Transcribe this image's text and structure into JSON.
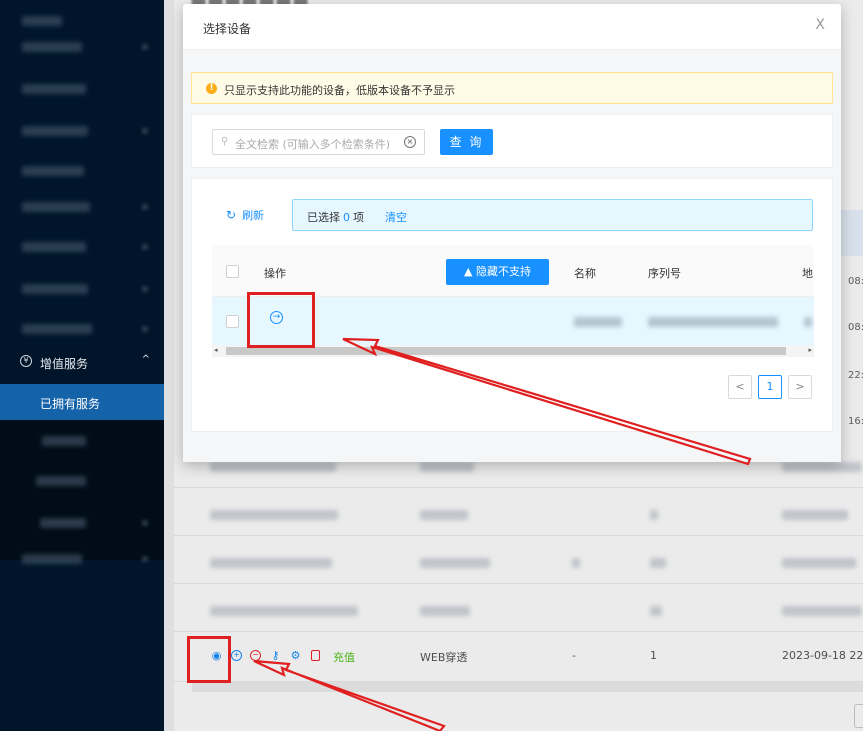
{
  "sidebar": {
    "group_label": "增值服务",
    "active_item": "已拥有服务"
  },
  "background": {
    "row": {
      "recharge_label": "充值",
      "name": "WEB穿透",
      "dash": "-",
      "count": "1",
      "date": "2023-09-18 22:"
    },
    "side_times": [
      "08:",
      "08:",
      "22:",
      "16:"
    ]
  },
  "modal": {
    "title": "选择设备",
    "close": "X",
    "notice": "只显示支持此功能的设备，低版本设备不予显示",
    "search": {
      "placeholder": "全文检索 (可输入多个检索条件)",
      "button": "查 询"
    },
    "toolbar": {
      "refresh": "刷新",
      "selected_prefix": "已选择",
      "selected_count": "0",
      "selected_suffix": "项",
      "clear": "清空"
    },
    "table": {
      "col_op": "操作",
      "hide_button": "隐藏不支持",
      "col_name": "名称",
      "col_serial": "序列号",
      "col_addr": "地"
    },
    "pagination": {
      "prev": "<",
      "current": "1",
      "next": ">"
    }
  },
  "colors": {
    "primary": "#1890ff",
    "sidebar": "#001529",
    "active": "#1463a8",
    "annotation": "#e02020"
  }
}
